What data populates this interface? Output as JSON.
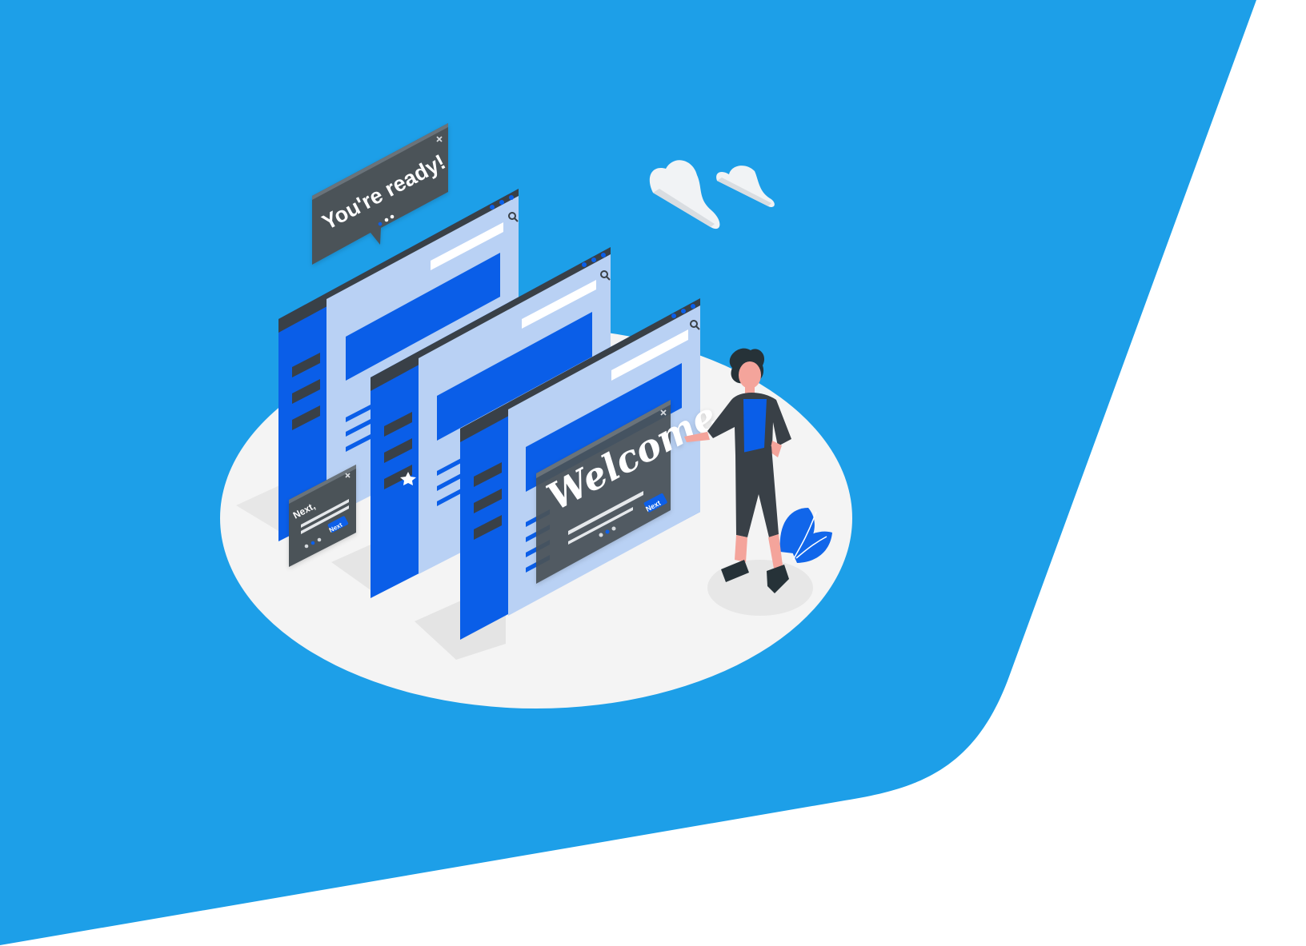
{
  "colors": {
    "banner_blue": "#1d9fe8",
    "window_blue": "#0a5ee8",
    "window_light": "#b9d1f4",
    "window_dark": "#394047",
    "popup_gray": "#4b5359",
    "floor": "#f4f4f4",
    "cloud": "#f1f3f5",
    "plant_blue": "#1166ea"
  },
  "popups": {
    "ready_text": "You're ready!",
    "next_small_text": "Next,",
    "next_button_small": "Next",
    "welcome_text": "Welcome",
    "welcome_next_button": "Next"
  },
  "icons": {
    "close": "close-icon",
    "search": "search-icon",
    "star": "star-icon"
  }
}
